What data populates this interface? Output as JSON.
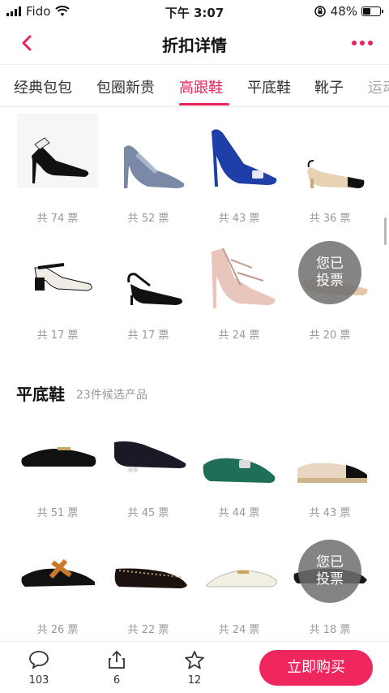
{
  "status_bar": {
    "carrier": "Fido",
    "time": "下午 3:07",
    "battery": "48%",
    "battery_level": 0.48
  },
  "nav": {
    "title": "折扣详情"
  },
  "tabs": [
    {
      "label": "经典包包"
    },
    {
      "label": "包圈新贵"
    },
    {
      "label": "高跟鞋"
    },
    {
      "label": "平底鞋"
    },
    {
      "label": "靴子"
    },
    {
      "label": "运动"
    }
  ],
  "heels": [
    {
      "votes": "共 74 票",
      "icon": "slingback-heel-black"
    },
    {
      "votes": "共 52 票",
      "icon": "glitter-pump"
    },
    {
      "votes": "共 43 票",
      "icon": "blue-satin-pump"
    },
    {
      "votes": "共 36 票",
      "icon": "two-tone-slingback"
    },
    {
      "votes": "共 17 票",
      "icon": "block-heel-slingback"
    },
    {
      "votes": "共 17 票",
      "icon": "kitten-heel-slingback"
    },
    {
      "votes": "共 24 票",
      "icon": "studded-pump"
    },
    {
      "votes": "共 20 票",
      "icon": "nude-slingback"
    }
  ],
  "flats_section": {
    "title": "平底鞋",
    "subtitle": "23件候选产品"
  },
  "flats": [
    {
      "votes": "共 51 票",
      "icon": "horsebit-loafer"
    },
    {
      "votes": "共 45 票",
      "icon": "velvet-slipper"
    },
    {
      "votes": "共 44 票",
      "icon": "green-buckle-flat"
    },
    {
      "votes": "共 43 票",
      "icon": "espadrille"
    },
    {
      "votes": "共 26 票",
      "icon": "tan-mule"
    },
    {
      "votes": "共 22 票",
      "icon": "studded-ballet-flat"
    },
    {
      "votes": "共 24 票",
      "icon": "white-horsebit-mule"
    },
    {
      "votes": "共 18 票",
      "icon": "black-mule"
    }
  ],
  "voted_badge": [
    "您已",
    "投票"
  ],
  "bottom_bar": {
    "comments": "103",
    "shares": "6",
    "favorites": "12",
    "buy_label": "立即购买"
  },
  "colors": {
    "accent": "#e6245a",
    "buy_button": "#f0265f"
  }
}
